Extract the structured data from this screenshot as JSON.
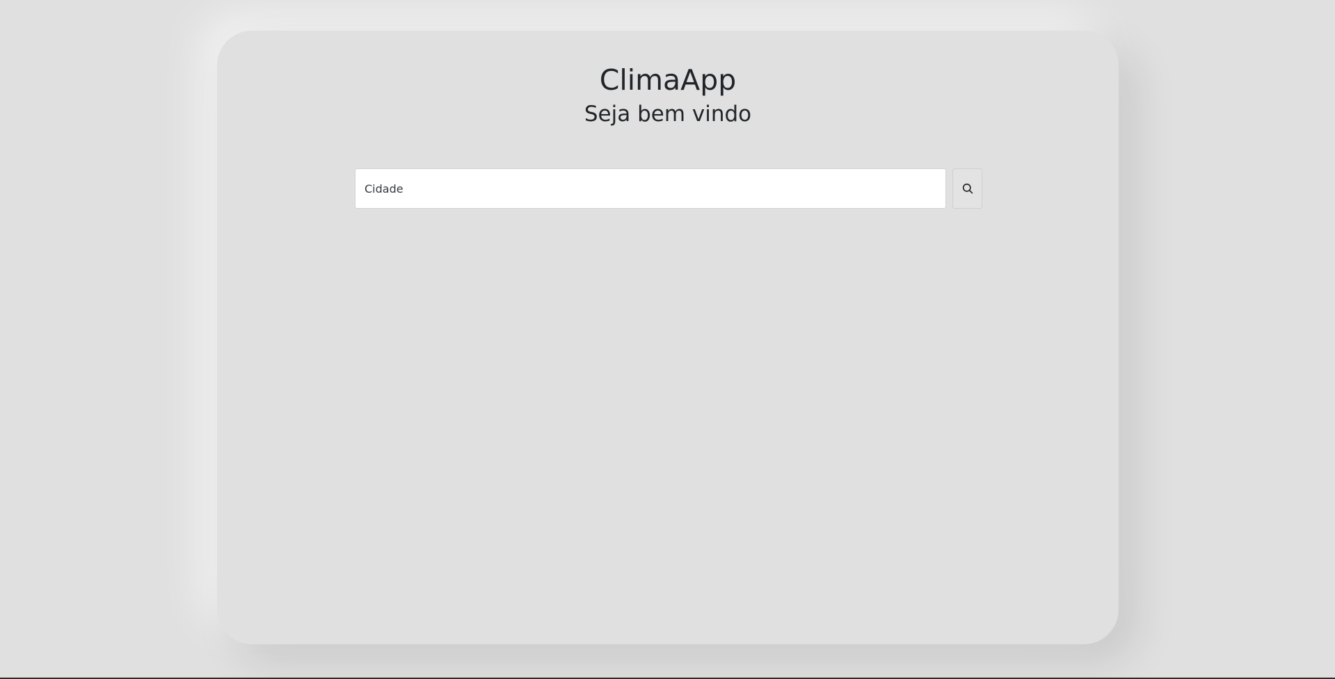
{
  "app": {
    "title": "ClimaApp",
    "subtitle": "Seja bem vindo"
  },
  "search": {
    "placeholder": "Cidade",
    "value": "",
    "button_icon": "search-icon"
  },
  "colors": {
    "background": "#e0e0e0",
    "card": "#e0e0e0",
    "text": "#212529",
    "input_bg": "#ffffff"
  }
}
